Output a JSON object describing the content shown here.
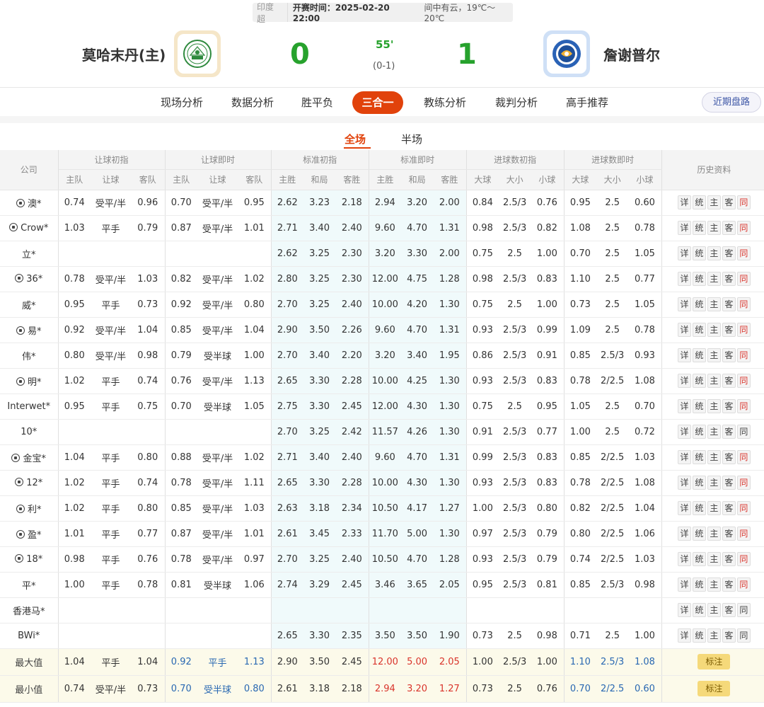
{
  "header": {
    "league": "印度超",
    "kickoff": "开赛时间：2025-02-20 22:00",
    "weather": "间中有云，19℃～20℃",
    "home_team": "莫哈末丹(主)",
    "away_team": "詹谢普尔",
    "home_score": "0",
    "away_score": "1",
    "minute": "55'",
    "half_score": "(0-1)",
    "home_logo": "home-team-crest",
    "away_logo": "away-team-crest"
  },
  "nav": {
    "tabs": [
      "现场分析",
      "数据分析",
      "胜平负",
      "三合一",
      "教练分析",
      "裁判分析",
      "高手推荐"
    ],
    "active": "三合一",
    "recent_button": "近期盘路"
  },
  "subtabs": {
    "full": "全场",
    "half": "半场",
    "active": "全场"
  },
  "table": {
    "groups": {
      "company": "公司",
      "hcap_init": "让球初指",
      "hcap_live": "让球即时",
      "std_init": "标准初指",
      "std_live": "标准即时",
      "ou_init": "进球数初指",
      "ou_live": "进球数即时",
      "history": "历史资料"
    },
    "sub": {
      "home": "主队",
      "hcap": "让球",
      "away": "客队",
      "win": "主胜",
      "draw": "和局",
      "lose": "客胜",
      "big": "大球",
      "size": "大小",
      "small": "小球"
    },
    "history_buttons": [
      "详",
      "统",
      "主",
      "客",
      "同"
    ],
    "rows": [
      {
        "company": "澳*",
        "ball": true,
        "hi": [
          "0.74",
          "受平/半",
          "0.96"
        ],
        "hl": [
          "0.70",
          "受平/半",
          "0.95"
        ],
        "si": [
          "2.62",
          "3.23",
          "2.18"
        ],
        "sl": [
          "2.94",
          "3.20",
          "2.00"
        ],
        "oi": [
          "0.84",
          "2.5/3",
          "0.76"
        ],
        "ol": [
          "0.95",
          "2.5",
          "0.60"
        ],
        "same_red": true
      },
      {
        "company": "Crow*",
        "ball": true,
        "hi": [
          "1.03",
          "平手",
          "0.79"
        ],
        "hl": [
          "0.87",
          "受平/半",
          "1.01"
        ],
        "si": [
          "2.71",
          "3.40",
          "2.40"
        ],
        "sl": [
          "9.60",
          "4.70",
          "1.31"
        ],
        "oi": [
          "0.98",
          "2.5/3",
          "0.82"
        ],
        "ol": [
          "1.08",
          "2.5",
          "0.78"
        ],
        "same_red": true
      },
      {
        "company": "立*",
        "ball": false,
        "hi": [
          "",
          "",
          ""
        ],
        "hl": [
          "",
          "",
          ""
        ],
        "si": [
          "2.62",
          "3.25",
          "2.30"
        ],
        "sl": [
          "3.20",
          "3.30",
          "2.00"
        ],
        "oi": [
          "0.75",
          "2.5",
          "1.00"
        ],
        "ol": [
          "0.70",
          "2.5",
          "1.05"
        ],
        "same_red": true
      },
      {
        "company": "36*",
        "ball": true,
        "hi": [
          "0.78",
          "受平/半",
          "1.03"
        ],
        "hl": [
          "0.82",
          "受平/半",
          "1.02"
        ],
        "si": [
          "2.80",
          "3.25",
          "2.30"
        ],
        "sl": [
          "12.00",
          "4.75",
          "1.28"
        ],
        "oi": [
          "0.98",
          "2.5/3",
          "0.83"
        ],
        "ol": [
          "1.10",
          "2.5",
          "0.77"
        ],
        "same_red": true
      },
      {
        "company": "威*",
        "ball": false,
        "hi": [
          "0.95",
          "平手",
          "0.73"
        ],
        "hl": [
          "0.92",
          "受平/半",
          "0.80"
        ],
        "si": [
          "2.70",
          "3.25",
          "2.40"
        ],
        "sl": [
          "10.00",
          "4.20",
          "1.30"
        ],
        "oi": [
          "0.75",
          "2.5",
          "1.00"
        ],
        "ol": [
          "0.73",
          "2.5",
          "1.05"
        ],
        "same_red": true
      },
      {
        "company": "易*",
        "ball": true,
        "hi": [
          "0.92",
          "受平/半",
          "1.04"
        ],
        "hl": [
          "0.85",
          "受平/半",
          "1.04"
        ],
        "si": [
          "2.90",
          "3.50",
          "2.26"
        ],
        "sl": [
          "9.60",
          "4.70",
          "1.31"
        ],
        "oi": [
          "0.93",
          "2.5/3",
          "0.99"
        ],
        "ol": [
          "1.09",
          "2.5",
          "0.78"
        ],
        "same_red": true
      },
      {
        "company": "伟*",
        "ball": false,
        "hi": [
          "0.80",
          "受平/半",
          "0.98"
        ],
        "hl": [
          "0.79",
          "受半球",
          "1.00"
        ],
        "si": [
          "2.70",
          "3.40",
          "2.20"
        ],
        "sl": [
          "3.20",
          "3.40",
          "1.95"
        ],
        "oi": [
          "0.86",
          "2.5/3",
          "0.91"
        ],
        "ol": [
          "0.85",
          "2.5/3",
          "0.93"
        ],
        "same_red": true
      },
      {
        "company": "明*",
        "ball": true,
        "hi": [
          "1.02",
          "平手",
          "0.74"
        ],
        "hl": [
          "0.76",
          "受平/半",
          "1.13"
        ],
        "si": [
          "2.65",
          "3.30",
          "2.28"
        ],
        "sl": [
          "10.00",
          "4.25",
          "1.30"
        ],
        "oi": [
          "0.93",
          "2.5/3",
          "0.83"
        ],
        "ol": [
          "0.78",
          "2/2.5",
          "1.08"
        ],
        "same_red": true
      },
      {
        "company": "Interwet*",
        "ball": false,
        "hi": [
          "0.95",
          "平手",
          "0.75"
        ],
        "hl": [
          "0.70",
          "受半球",
          "1.05"
        ],
        "si": [
          "2.75",
          "3.30",
          "2.45"
        ],
        "sl": [
          "12.00",
          "4.30",
          "1.30"
        ],
        "oi": [
          "0.75",
          "2.5",
          "0.95"
        ],
        "ol": [
          "1.05",
          "2.5",
          "0.70"
        ],
        "same_red": true
      },
      {
        "company": "10*",
        "ball": false,
        "hi": [
          "",
          "",
          ""
        ],
        "hl": [
          "",
          "",
          ""
        ],
        "si": [
          "2.70",
          "3.25",
          "2.42"
        ],
        "sl": [
          "11.57",
          "4.26",
          "1.30"
        ],
        "oi": [
          "0.91",
          "2.5/3",
          "0.77"
        ],
        "ol": [
          "1.00",
          "2.5",
          "0.72"
        ],
        "same_red": false
      },
      {
        "company": "金宝*",
        "ball": true,
        "hi": [
          "1.04",
          "平手",
          "0.80"
        ],
        "hl": [
          "0.88",
          "受平/半",
          "1.02"
        ],
        "si": [
          "2.71",
          "3.40",
          "2.40"
        ],
        "sl": [
          "9.60",
          "4.70",
          "1.31"
        ],
        "oi": [
          "0.99",
          "2.5/3",
          "0.83"
        ],
        "ol": [
          "0.85",
          "2/2.5",
          "1.03"
        ],
        "same_red": true
      },
      {
        "company": "12*",
        "ball": true,
        "hi": [
          "1.02",
          "平手",
          "0.74"
        ],
        "hl": [
          "0.78",
          "受平/半",
          "1.11"
        ],
        "si": [
          "2.65",
          "3.30",
          "2.28"
        ],
        "sl": [
          "10.00",
          "4.30",
          "1.30"
        ],
        "oi": [
          "0.93",
          "2.5/3",
          "0.83"
        ],
        "ol": [
          "0.78",
          "2/2.5",
          "1.08"
        ],
        "same_red": true
      },
      {
        "company": "利*",
        "ball": true,
        "hi": [
          "1.02",
          "平手",
          "0.80"
        ],
        "hl": [
          "0.85",
          "受平/半",
          "1.03"
        ],
        "si": [
          "2.63",
          "3.18",
          "2.34"
        ],
        "sl": [
          "10.50",
          "4.17",
          "1.27"
        ],
        "oi": [
          "1.00",
          "2.5/3",
          "0.80"
        ],
        "ol": [
          "0.82",
          "2/2.5",
          "1.04"
        ],
        "same_red": true
      },
      {
        "company": "盈*",
        "ball": true,
        "hi": [
          "1.01",
          "平手",
          "0.77"
        ],
        "hl": [
          "0.87",
          "受平/半",
          "1.01"
        ],
        "si": [
          "2.61",
          "3.45",
          "2.33"
        ],
        "sl": [
          "11.70",
          "5.00",
          "1.30"
        ],
        "oi": [
          "0.97",
          "2.5/3",
          "0.79"
        ],
        "ol": [
          "0.80",
          "2/2.5",
          "1.06"
        ],
        "same_red": true
      },
      {
        "company": "18*",
        "ball": true,
        "hi": [
          "0.98",
          "平手",
          "0.76"
        ],
        "hl": [
          "0.78",
          "受平/半",
          "0.97"
        ],
        "si": [
          "2.70",
          "3.25",
          "2.40"
        ],
        "sl": [
          "10.50",
          "4.70",
          "1.28"
        ],
        "oi": [
          "0.93",
          "2.5/3",
          "0.79"
        ],
        "ol": [
          "0.74",
          "2/2.5",
          "1.03"
        ],
        "same_red": true
      },
      {
        "company": "平*",
        "ball": false,
        "hi": [
          "1.00",
          "平手",
          "0.78"
        ],
        "hl": [
          "0.81",
          "受半球",
          "1.06"
        ],
        "si": [
          "2.74",
          "3.29",
          "2.45"
        ],
        "sl": [
          "3.46",
          "3.65",
          "2.05"
        ],
        "oi": [
          "0.95",
          "2.5/3",
          "0.81"
        ],
        "ol": [
          "0.85",
          "2.5/3",
          "0.98"
        ],
        "same_red": true
      },
      {
        "company": "香港马*",
        "ball": false,
        "hi": [
          "",
          "",
          ""
        ],
        "hl": [
          "",
          "",
          ""
        ],
        "si": [
          "",
          "",
          ""
        ],
        "sl": [
          "",
          "",
          ""
        ],
        "oi": [
          "",
          "",
          ""
        ],
        "ol": [
          "",
          "",
          ""
        ],
        "same_red": false
      },
      {
        "company": "BWi*",
        "ball": false,
        "hi": [
          "",
          "",
          ""
        ],
        "hl": [
          "",
          "",
          ""
        ],
        "si": [
          "2.65",
          "3.30",
          "2.35"
        ],
        "sl": [
          "3.50",
          "3.50",
          "1.90"
        ],
        "oi": [
          "0.73",
          "2.5",
          "0.98"
        ],
        "ol": [
          "0.71",
          "2.5",
          "1.00"
        ],
        "same_red": false
      }
    ],
    "summary": [
      {
        "label": "最大值",
        "hi": [
          "1.04",
          "平手",
          "1.04"
        ],
        "hl": [
          "0.92",
          "平手",
          "1.13"
        ],
        "si": [
          "2.90",
          "3.50",
          "2.45"
        ],
        "sl": [
          "12.00",
          "5.00",
          "2.05"
        ],
        "oi": [
          "1.00",
          "2.5/3",
          "1.00"
        ],
        "ol": [
          "1.10",
          "2.5/3",
          "1.08"
        ],
        "mark": "标注"
      },
      {
        "label": "最小值",
        "hi": [
          "0.74",
          "受平/半",
          "0.73"
        ],
        "hl": [
          "0.70",
          "受半球",
          "0.80"
        ],
        "si": [
          "2.61",
          "3.18",
          "2.18"
        ],
        "sl": [
          "2.94",
          "3.20",
          "1.27"
        ],
        "oi": [
          "0.73",
          "2.5",
          "0.76"
        ],
        "ol": [
          "0.70",
          "2/2.5",
          "0.60"
        ],
        "mark": "标注"
      }
    ]
  },
  "colors": {
    "accent": "#e1420b",
    "score_green": "#27a22d",
    "live_blue": "#2968b2",
    "extreme_red": "#d9342b"
  }
}
